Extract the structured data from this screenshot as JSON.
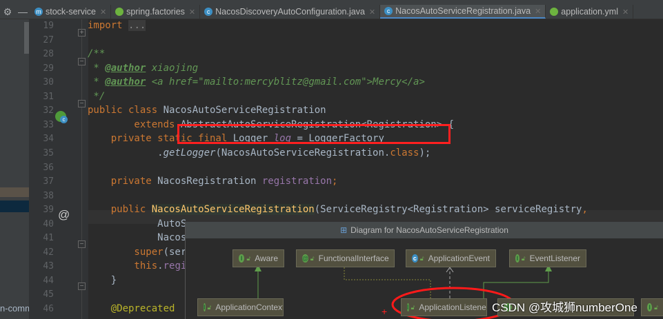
{
  "tabs": [
    {
      "label": "stock-service",
      "icon": "maven-module-icon",
      "active": false
    },
    {
      "label": "spring.factories",
      "icon": "spring-icon",
      "active": false
    },
    {
      "label": "NacosDiscoveryAutoConfiguration.java",
      "icon": "class-icon",
      "active": false
    },
    {
      "label": "NacosAutoServiceRegistration.java",
      "icon": "class-icon",
      "active": true
    },
    {
      "label": "application.yml",
      "icon": "spring-config-icon",
      "active": false
    }
  ],
  "sidebar": {
    "tree_text": "n-commc"
  },
  "lines": [
    {
      "n": "19",
      "tokens": [
        [
          "import ",
          "k"
        ],
        [
          "...",
          "fold-txt"
        ]
      ]
    },
    {
      "n": "27",
      "tokens": []
    },
    {
      "n": "28",
      "tokens": [
        [
          "/**",
          "c"
        ]
      ]
    },
    {
      "n": "29",
      "tokens": [
        [
          " * ",
          "c"
        ],
        [
          "@author",
          "ct"
        ],
        [
          " xiaojing",
          "c"
        ]
      ]
    },
    {
      "n": "30",
      "tokens": [
        [
          " * ",
          "c"
        ],
        [
          "@author",
          "ct"
        ],
        [
          " <a href=\"mailto:mercyblitz@gmail.com\">Mercy</a>",
          "c"
        ]
      ]
    },
    {
      "n": "31",
      "tokens": [
        [
          " */",
          "c"
        ]
      ]
    },
    {
      "n": "32",
      "tokens": [
        [
          "public class ",
          "k"
        ],
        [
          "NacosAutoServiceRegistration",
          ""
        ]
      ]
    },
    {
      "n": "33",
      "tokens": [
        [
          "        extends ",
          "k"
        ],
        [
          "AbstractAutoServiceRegistration<Registration> {",
          ""
        ]
      ]
    },
    {
      "n": "34",
      "tokens": [
        [
          "    private static final ",
          "k"
        ],
        [
          "Logger ",
          ""
        ],
        [
          "log",
          "fi"
        ],
        [
          " = LoggerFactory",
          ""
        ]
      ]
    },
    {
      "n": "35",
      "tokens": [
        [
          "            .",
          ""
        ],
        [
          "getLogger",
          "i"
        ],
        [
          "(NacosAutoServiceRegistration.",
          ""
        ],
        [
          "class",
          "k"
        ],
        [
          ");",
          ""
        ]
      ]
    },
    {
      "n": "36",
      "tokens": []
    },
    {
      "n": "37",
      "tokens": [
        [
          "    private ",
          "k"
        ],
        [
          "NacosRegistration ",
          ""
        ],
        [
          "registration",
          "f"
        ],
        [
          ";",
          "k"
        ]
      ]
    },
    {
      "n": "38",
      "tokens": []
    },
    {
      "n": "39",
      "tokens": [
        [
          "    public ",
          "k"
        ],
        [
          "NacosAutoServiceRegistration",
          "g"
        ],
        [
          "(ServiceRegistry<Registration> serviceRegistry",
          ""
        ],
        [
          ",",
          "k"
        ]
      ]
    },
    {
      "n": "40",
      "tokens": [
        [
          "            AutoS",
          ""
        ]
      ]
    },
    {
      "n": "41",
      "tokens": [
        [
          "            Nacos",
          ""
        ]
      ]
    },
    {
      "n": "42",
      "tokens": [
        [
          "        super",
          "k"
        ],
        [
          "(ser",
          ""
        ]
      ]
    },
    {
      "n": "43",
      "tokens": [
        [
          "        this",
          "k"
        ],
        [
          ".",
          ""
        ],
        [
          "regi",
          "f"
        ]
      ]
    },
    {
      "n": "44",
      "tokens": [
        [
          "    }",
          ""
        ]
      ]
    },
    {
      "n": "45",
      "tokens": []
    },
    {
      "n": "46",
      "tokens": [
        [
          "    @Deprecated",
          "a"
        ]
      ]
    }
  ],
  "diagram": {
    "title": "Diagram for NacosAutoServiceRegistration",
    "nodes": [
      {
        "label": "Aware",
        "kind": "I"
      },
      {
        "label": "FunctionalInterface",
        "kind": "@"
      },
      {
        "label": "ApplicationEvent",
        "kind": "C"
      },
      {
        "label": "EventListener",
        "kind": "I"
      },
      {
        "label": "ApplicationContextAware",
        "kind": "I"
      },
      {
        "label": "ApplicationListener",
        "kind": "I"
      },
      {
        "label": "",
        "kind": "I"
      },
      {
        "label": "",
        "kind": "I"
      }
    ]
  },
  "watermark": "CSDN @攻城狮numberOne"
}
